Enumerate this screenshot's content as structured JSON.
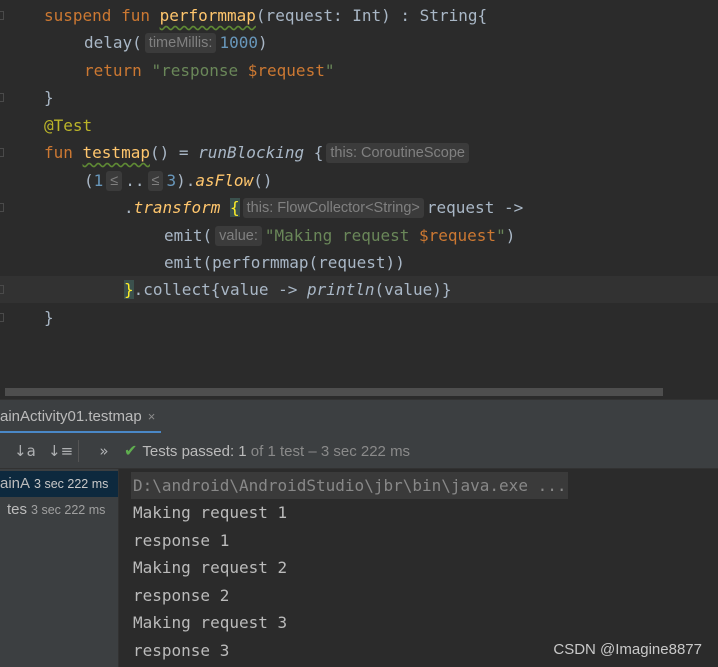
{
  "editor": {
    "lines": {
      "l1": {
        "kw1": "suspend fun ",
        "fn": "performmap",
        "rest": "(request: Int) : String{"
      },
      "l2": {
        "pre": "delay(",
        "hint": "timeMillis:",
        "num": "1000",
        "post": ")"
      },
      "l3": {
        "kw": "return ",
        "str1": "\"response ",
        "var": "$request",
        "str2": "\""
      },
      "l4": {
        "text": "}"
      },
      "l5": {
        "ann": "@Test"
      },
      "l6": {
        "kw": "fun ",
        "fn": "testmap",
        "mid": "() = ",
        "it": "runBlocking",
        "brace": " {",
        "hint": "this: CoroutineScope"
      },
      "l7": {
        "open": "(",
        "n1": "1",
        "le1": "≤",
        "dots": "..",
        "le2": "≤",
        "n2": "3",
        "close": ").",
        "it": "asFlow",
        "end": "()"
      },
      "l8": {
        "pre": ".",
        "it": "transform",
        "brace": "{",
        "hint": "this: FlowCollector<String>",
        "post": "request ->"
      },
      "l9": {
        "pre": "emit(",
        "hint": "value:",
        "str1": "\"Making request ",
        "var": "$request",
        "str2": "\"",
        "post": ")"
      },
      "l10": {
        "text": "emit(performmap(request))"
      },
      "l11": {
        "brace": "}",
        "mid": ".collect{value -> ",
        "it": "println",
        "post": "(value)}"
      },
      "l12": {
        "text": "}"
      }
    }
  },
  "run_panel": {
    "tab_label": "ainActivity01.testmap",
    "tab_close": "×",
    "sort_alpha_icon": "↓a",
    "sort_duration_icon": "↓≡",
    "expand_icon": "»",
    "status_passed": "Tests passed: ",
    "status_count": "1",
    "status_rest": " of 1 test – 3 sec 222 ms",
    "tree": [
      {
        "label": "ainA",
        "time": "3 sec 222 ms"
      },
      {
        "label": "tes",
        "time": "3 sec 222 ms"
      }
    ],
    "console": [
      "D:\\android\\AndroidStudio\\jbr\\bin\\java.exe ...",
      "Making request 1",
      "response 1",
      "Making request 2",
      "response 2",
      "Making request 3",
      "response 3"
    ]
  },
  "watermark": "CSDN @Imagine8877",
  "colors": {
    "keyword": "#cc7832",
    "function": "#ffc66d",
    "string": "#6a8759",
    "number": "#6897bb",
    "annotation": "#bbb529",
    "passed": "#5fae4f"
  }
}
